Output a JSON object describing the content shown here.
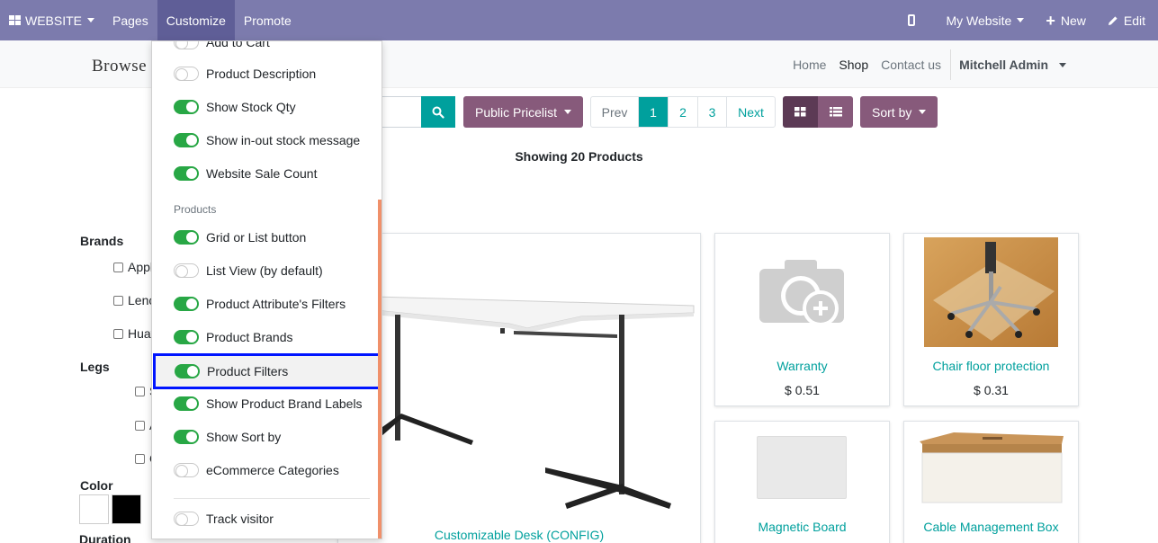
{
  "topbar": {
    "website_label": "WEBSITE",
    "pages_label": "Pages",
    "customize_label": "Customize",
    "promote_label": "Promote",
    "my_website_label": "My Website",
    "new_label": "New",
    "edit_label": "Edit"
  },
  "header": {
    "logo": "Browse",
    "nav": [
      "Home",
      "Shop",
      "Contact us"
    ],
    "user": "Mitchell Admin"
  },
  "toolbar": {
    "pricelist_label": "Public Pricelist",
    "pager": [
      "Prev",
      "1",
      "2",
      "3",
      "Next"
    ],
    "sort_label": "Sort by"
  },
  "showing_text": "Showing 20 Products",
  "filters": {
    "brands_title": "Brands",
    "brands": [
      "Appl",
      "Lenc",
      "Huav"
    ],
    "legs_title": "Legs",
    "legs": [
      "S",
      "A",
      "C"
    ],
    "color_title": "Color",
    "colors": [
      "#ffffff",
      "#000000"
    ],
    "duration_title": "Duration"
  },
  "products": [
    {
      "name": "Customizable Desk (CONFIG)",
      "price": ""
    },
    {
      "name": "Warranty",
      "price": "$ 0.51"
    },
    {
      "name": "Chair floor protection",
      "price": "$ 0.31"
    },
    {
      "name": "Magnetic Board",
      "price": ""
    },
    {
      "name": "Cable Management Box",
      "price": ""
    }
  ],
  "customize_menu": {
    "items_top": [
      {
        "label": "Add to Cart",
        "on": false
      },
      {
        "label": "Product Description",
        "on": false
      },
      {
        "label": "Show Stock Qty",
        "on": true
      },
      {
        "label": "Show in-out stock message",
        "on": true
      },
      {
        "label": "Website Sale Count",
        "on": true
      }
    ],
    "products_header": "Products",
    "items_products": [
      {
        "label": "Grid or List button",
        "on": true
      },
      {
        "label": "List View (by default)",
        "on": false
      },
      {
        "label": "Product Attribute's Filters",
        "on": true
      },
      {
        "label": "Product Brands",
        "on": true
      },
      {
        "label": "Product Filters",
        "on": true
      },
      {
        "label": "Show Product Brand Labels",
        "on": true
      },
      {
        "label": "Show Sort by",
        "on": true
      },
      {
        "label": "eCommerce Categories",
        "on": false
      }
    ],
    "track_visitor": {
      "label": "Track visitor",
      "on": false
    }
  }
}
